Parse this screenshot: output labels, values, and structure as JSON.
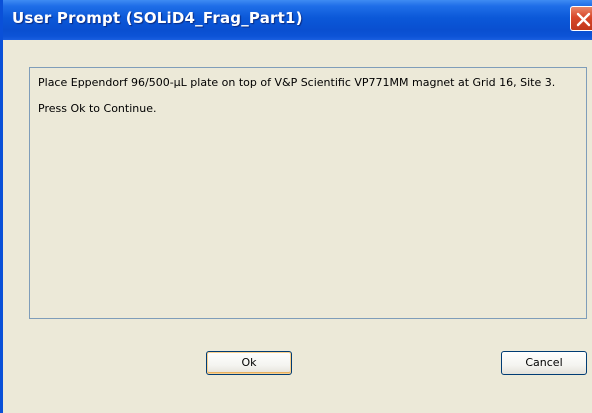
{
  "window": {
    "title": "User Prompt (SOLiD4_Frag_Part1)",
    "close_icon": "close-icon",
    "titlebar_color": "#0a50d8",
    "close_color": "#d8472a"
  },
  "message": {
    "lines": [
      "Place Eppendorf 96/500-µL plate on top of V&P Scientific VP771MM magnet at Grid 16, Site 3.",
      "Press Ok to Continue."
    ]
  },
  "buttons": {
    "ok_label": "Ok",
    "cancel_label": "Cancel"
  }
}
